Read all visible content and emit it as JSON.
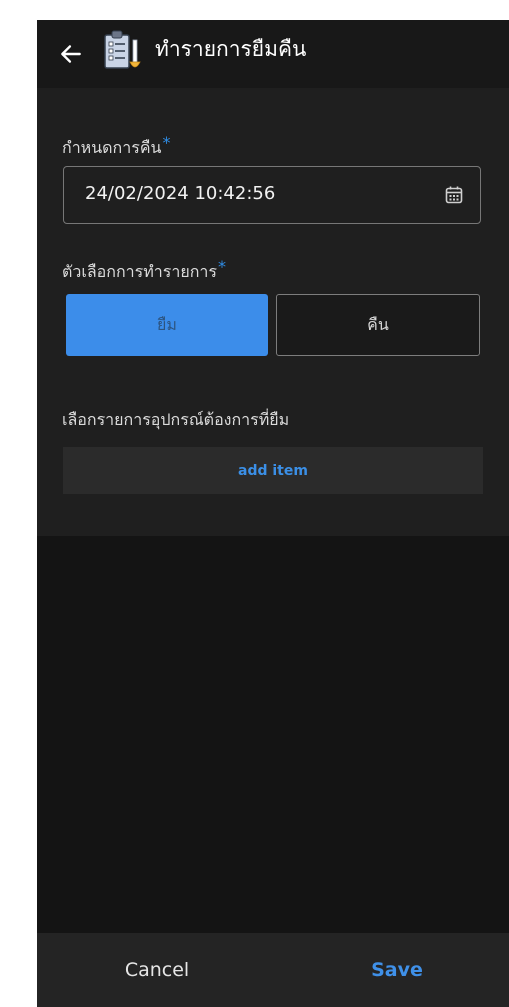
{
  "header": {
    "title": "ทำรายการยืมคืน",
    "back_icon": "arrow-left-icon",
    "app_icon": "clipboard-checklist-icon"
  },
  "form": {
    "return_date": {
      "label": "กำหนดการคืน",
      "required_mark": "*",
      "value": "24/02/2024 10:42:56",
      "icon": "calendar-icon"
    },
    "transaction_type": {
      "label": "ตัวเลือกการทำรายการ",
      "required_mark": "*",
      "options": [
        "ยืม",
        "คืน"
      ],
      "selected": "ยืม"
    },
    "equipment": {
      "label": "เลือกรายการอุปกรณ์ต้องการที่ยืม",
      "add_button": "add item"
    }
  },
  "footer": {
    "cancel_label": "Cancel",
    "save_label": "Save"
  },
  "colors": {
    "accent": "#3c8dea",
    "background": "#141414",
    "panel": "#1f1f1f",
    "footer": "#242424"
  }
}
